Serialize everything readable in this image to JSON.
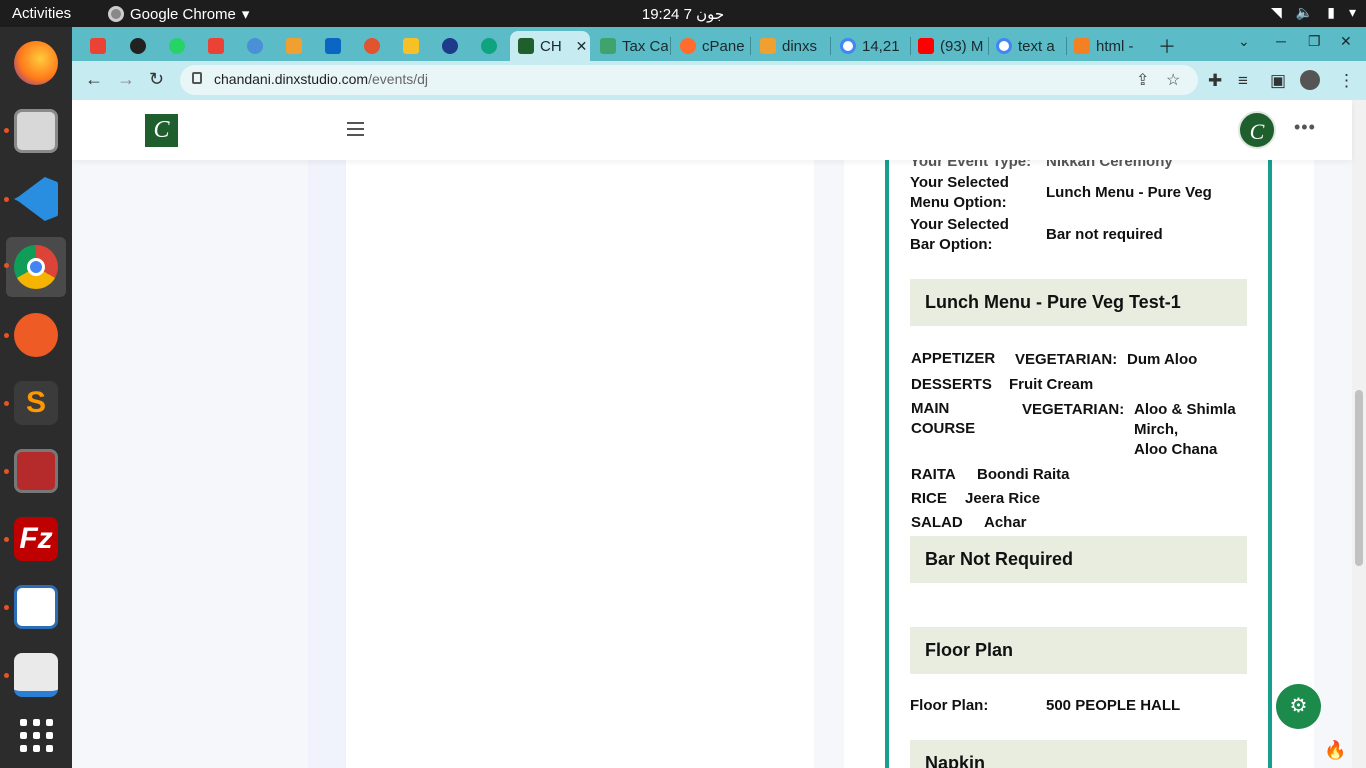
{
  "system_bar": {
    "activities": "Activities",
    "app_name": "Google Chrome",
    "clock": "19:24  جون 7"
  },
  "browser": {
    "tabs": [
      {
        "label": "",
        "icon": "gmail-icon"
      },
      {
        "label": "",
        "icon": "github-icon"
      },
      {
        "label": "",
        "icon": "whatsapp-icon"
      },
      {
        "label": "",
        "icon": "gmail-icon"
      },
      {
        "label": "",
        "icon": "bubble-icon"
      },
      {
        "label": "",
        "icon": "pma-icon"
      },
      {
        "label": "",
        "icon": "linkedin-icon"
      },
      {
        "label": "",
        "icon": "compass-icon"
      },
      {
        "label": "",
        "icon": "drive-icon"
      },
      {
        "label": "",
        "icon": "circle-arrow-icon"
      },
      {
        "label": "",
        "icon": "openai-icon"
      },
      {
        "label": "CH",
        "icon": "chandani-icon",
        "active": true
      },
      {
        "label": "Tax Ca",
        "icon": "tax-icon"
      },
      {
        "label": "cPane",
        "icon": "cpanel-icon"
      },
      {
        "label": "dinxs",
        "icon": "pma-icon"
      },
      {
        "label": "14,21",
        "icon": "google-icon"
      },
      {
        "label": "(93) M",
        "icon": "youtube-icon"
      },
      {
        "label": "text a",
        "icon": "google-icon"
      },
      {
        "label": "html -",
        "icon": "stackoverflow-icon"
      }
    ],
    "url_host": "chandani.dinxstudio.com",
    "url_path": "/events/dj"
  },
  "event_details": {
    "event_type_label": "Your Event Type:",
    "event_type_value": "Nikkah Ceremony",
    "menu_option_label": "Your Selected Menu Option:",
    "menu_option_value": "Lunch Menu - Pure Veg",
    "bar_option_label": "Your Selected Bar Option:",
    "bar_option_value": "Bar not required"
  },
  "menu": {
    "heading": "Lunch Menu - Pure Veg Test-1",
    "appetizer_course": "APPETIZER",
    "appetizer_cat": "VEGETARIAN:",
    "appetizer_item": "Dum Aloo",
    "desserts_course": "DESSERTS",
    "desserts_item": "Fruit Cream",
    "main_course_1": "MAIN",
    "main_course_2": "COURSE",
    "main_cat": "VEGETARIAN:",
    "main_item_1": "Aloo & Shimla",
    "main_item_2": "Mirch,",
    "main_item_3": "Aloo Chana",
    "raita_course": "RAITA",
    "raita_item": "Boondi Raita",
    "rice_course": "RICE",
    "rice_item": "Jeera Rice",
    "salad_course": "SALAD",
    "salad_item": "Achar"
  },
  "bar": {
    "heading": "Bar Not Required"
  },
  "floor_plan": {
    "heading": "Floor Plan",
    "label": "Floor Plan:",
    "value": "500 PEOPLE HALL"
  },
  "napkin": {
    "heading": "Napkin"
  },
  "colors": {
    "accent": "#179e8c",
    "brand_green": "#1f5f2e",
    "tab_strip": "#5bbbc7"
  }
}
